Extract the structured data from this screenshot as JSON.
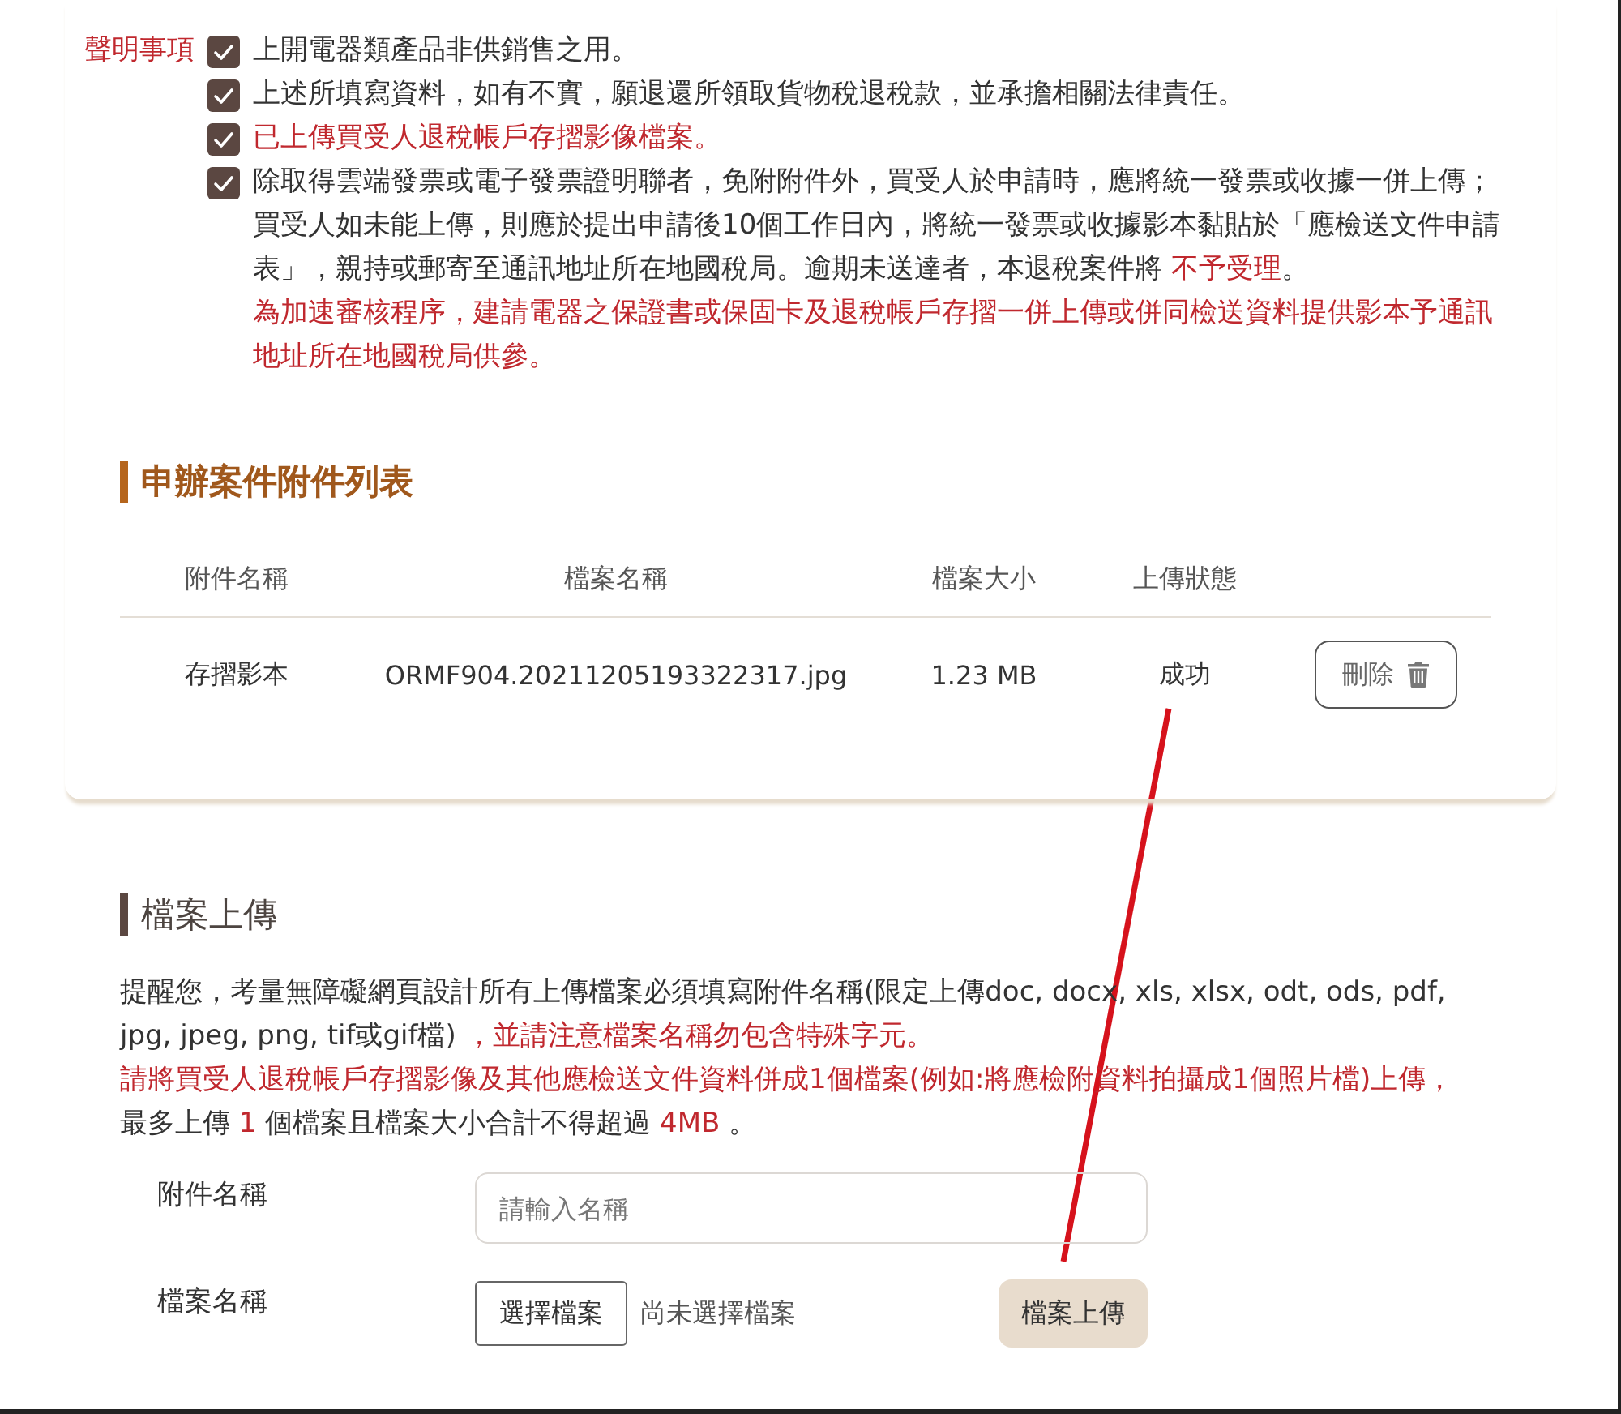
{
  "declarations": {
    "label": "聲明事項",
    "items": [
      {
        "checked": true,
        "segments": [
          {
            "text": "上開電器類產品非供銷售之用。",
            "warning": false
          }
        ]
      },
      {
        "checked": true,
        "segments": [
          {
            "text": "上述所填寫資料，如有不實，願退還所領取貨物稅退稅款，並承擔相關法律責任。",
            "warning": false
          }
        ]
      },
      {
        "checked": true,
        "segments": [
          {
            "text": "已上傳買受人退稅帳戶存摺影像檔案。",
            "warning": true
          }
        ]
      },
      {
        "checked": true,
        "segments": [
          {
            "text": "除取得雲端發票或電子發票證明聯者，免附附件外，買受人於申請時，應將統一發票或收據一併上傳；買受人如未能上傳，則應於提出申請後10個工作日內，將統一發票或收據影本黏貼於「應檢送文件申請表」，親持或郵寄至通訊地址所在地國稅局。逾期未送達者，本退稅案件將 ",
            "warning": false
          },
          {
            "text": "不予受理",
            "warning": true
          },
          {
            "text": "。",
            "warning": false
          }
        ],
        "note": "為加速審核程序，建請電器之保證書或保固卡及退稅帳戶存摺一併上傳或併同檢送資料提供影本予通訊地址所在地國稅局供參。"
      }
    ]
  },
  "attachments": {
    "title": "申辦案件附件列表",
    "columns": [
      "附件名稱",
      "檔案名稱",
      "檔案大小",
      "上傳狀態"
    ],
    "rows": [
      {
        "cells": [
          "存摺影本",
          "ORMF904.20211205193322317.jpg",
          "1.23 MB",
          "成功"
        ],
        "action": "刪除"
      }
    ]
  },
  "upload": {
    "title": "檔案上傳",
    "notice": [
      [
        {
          "text": "提醒您，考量無障礙網頁設計所有上傳檔案必須填寫附件名稱(限定上傳doc, docx, xls, xlsx, odt, ods, pdf, jpg, jpeg, png, tif或gif檔)",
          "warning": false
        },
        {
          "text": " ，並請注意檔案名稱勿包含特殊字元。",
          "warning": true
        }
      ],
      [
        {
          "text": "請將買受人退稅帳戶存摺影像及其他應檢送文件資料併成1個檔案(例如:將應檢附資料拍攝成1個照片檔)上傳，",
          "warning": true
        }
      ],
      [
        {
          "text": "最多上傳 ",
          "warning": false
        },
        {
          "text": "1",
          "warning": true
        },
        {
          "text": " 個檔案且檔案大小合計不得超過 ",
          "warning": false
        },
        {
          "text": "4MB",
          "warning": true
        },
        {
          "text": " 。",
          "warning": false
        }
      ]
    ],
    "fields": [
      {
        "kind": "text",
        "label": "附件名稱",
        "placeholder": "請輸入名稱"
      },
      {
        "kind": "file",
        "label": "檔案名稱",
        "button": "選擇檔案",
        "status": "尚未選擇檔案",
        "submit": "檔案上傳"
      }
    ]
  }
}
